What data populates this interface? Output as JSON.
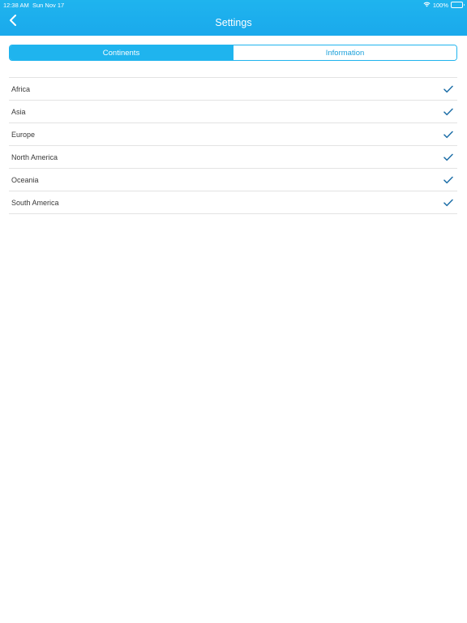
{
  "status_bar": {
    "time": "12:38 AM",
    "date": "Sun Nov 17",
    "battery": "100%"
  },
  "nav": {
    "title": "Settings",
    "back_icon": "chevron-left-icon"
  },
  "tabs": [
    {
      "label": "Continents",
      "selected": true
    },
    {
      "label": "Information",
      "selected": false
    }
  ],
  "continents": [
    {
      "label": "Africa",
      "checked": true
    },
    {
      "label": "Asia",
      "checked": true
    },
    {
      "label": "Europe",
      "checked": true
    },
    {
      "label": "North America",
      "checked": true
    },
    {
      "label": "Oceania",
      "checked": true
    },
    {
      "label": "South America",
      "checked": true
    }
  ],
  "colors": {
    "header": "#1fb4ee",
    "accent": "#1aa0da",
    "check": "#1e6fa8"
  }
}
